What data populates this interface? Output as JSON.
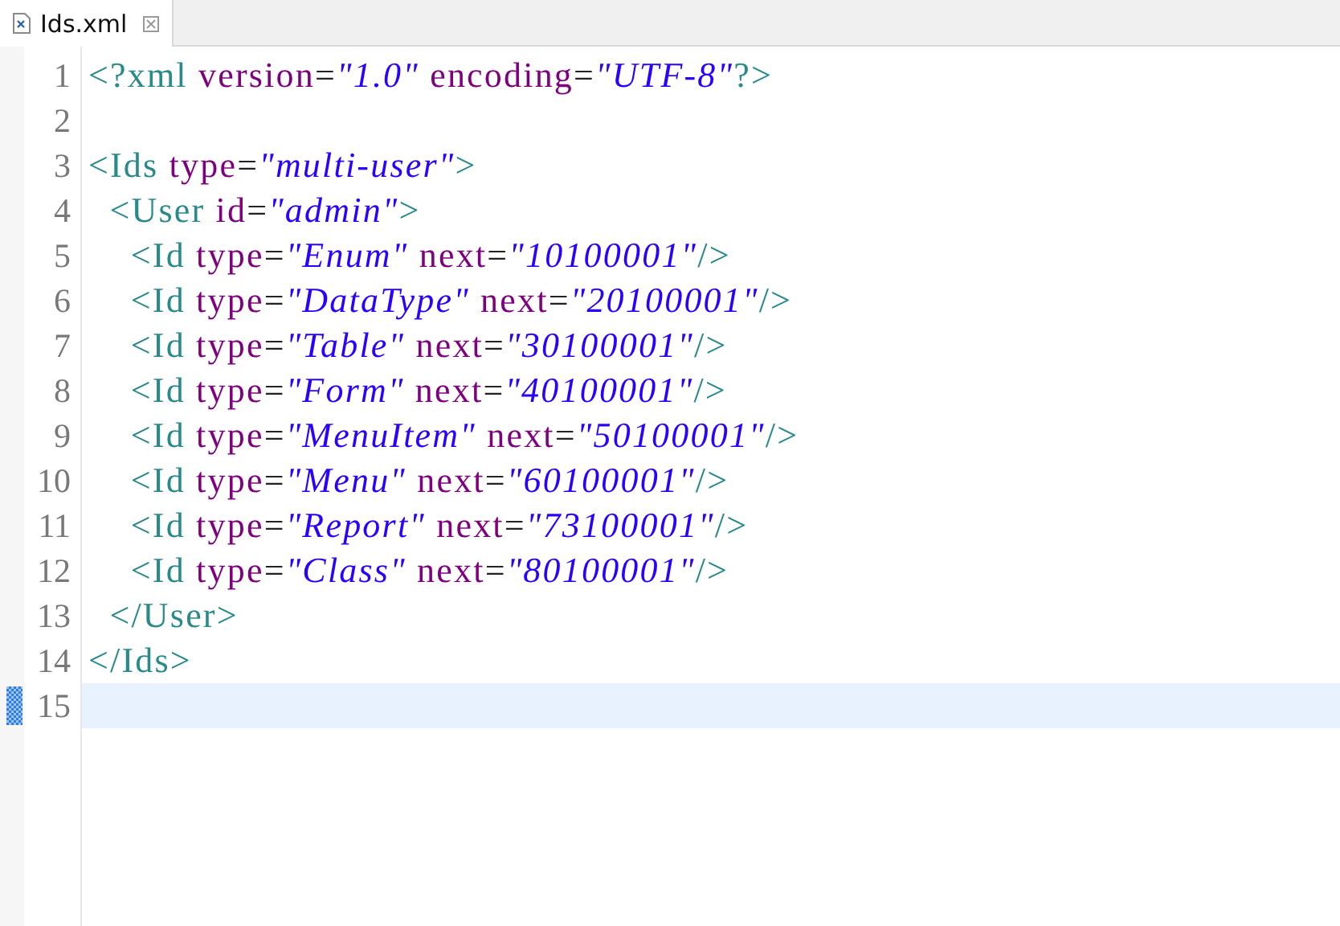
{
  "tabs": [
    {
      "title": "Ids.xml",
      "selected": true
    }
  ],
  "lines": [
    {
      "number": "1",
      "current": false,
      "tokens": [
        {
          "kind": "tag",
          "text": "<?xml"
        },
        {
          "kind": "attr",
          "text": " version"
        },
        {
          "kind": "eq",
          "text": "="
        },
        {
          "kind": "value",
          "text": "\"1.0\""
        },
        {
          "kind": "attr",
          "text": " encoding"
        },
        {
          "kind": "eq",
          "text": "="
        },
        {
          "kind": "value",
          "text": "\"UTF-8\""
        },
        {
          "kind": "tag",
          "text": "?>"
        }
      ]
    },
    {
      "number": "2",
      "current": false
    },
    {
      "number": "3",
      "current": false,
      "tokens": [
        {
          "kind": "tag",
          "text": "<Ids"
        },
        {
          "kind": "attr",
          "text": " type"
        },
        {
          "kind": "eq",
          "text": "="
        },
        {
          "kind": "value",
          "text": "\"multi-user\""
        },
        {
          "kind": "tag",
          "text": ">"
        }
      ]
    },
    {
      "number": "4",
      "current": false,
      "tokens": [
        {
          "kind": "tag",
          "text": "  <User"
        },
        {
          "kind": "attr",
          "text": " id"
        },
        {
          "kind": "eq",
          "text": "="
        },
        {
          "kind": "value",
          "text": "\"admin\""
        },
        {
          "kind": "tag",
          "text": ">"
        }
      ]
    },
    {
      "number": "5",
      "current": false,
      "tokens": [
        {
          "kind": "tag",
          "text": "    <Id"
        },
        {
          "kind": "attr",
          "text": " type"
        },
        {
          "kind": "eq",
          "text": "="
        },
        {
          "kind": "value",
          "text": "\"Enum\""
        },
        {
          "kind": "attr",
          "text": " next"
        },
        {
          "kind": "eq",
          "text": "="
        },
        {
          "kind": "value",
          "text": "\"10100001\""
        },
        {
          "kind": "tag",
          "text": "/>"
        }
      ]
    },
    {
      "number": "6",
      "current": false,
      "tokens": [
        {
          "kind": "tag",
          "text": "    <Id"
        },
        {
          "kind": "attr",
          "text": " type"
        },
        {
          "kind": "eq",
          "text": "="
        },
        {
          "kind": "value",
          "text": "\"DataType\""
        },
        {
          "kind": "attr",
          "text": " next"
        },
        {
          "kind": "eq",
          "text": "="
        },
        {
          "kind": "value",
          "text": "\"20100001\""
        },
        {
          "kind": "tag",
          "text": "/>"
        }
      ]
    },
    {
      "number": "7",
      "current": false,
      "tokens": [
        {
          "kind": "tag",
          "text": "    <Id"
        },
        {
          "kind": "attr",
          "text": " type"
        },
        {
          "kind": "eq",
          "text": "="
        },
        {
          "kind": "value",
          "text": "\"Table\""
        },
        {
          "kind": "attr",
          "text": " next"
        },
        {
          "kind": "eq",
          "text": "="
        },
        {
          "kind": "value",
          "text": "\"30100001\""
        },
        {
          "kind": "tag",
          "text": "/>"
        }
      ]
    },
    {
      "number": "8",
      "current": false,
      "tokens": [
        {
          "kind": "tag",
          "text": "    <Id"
        },
        {
          "kind": "attr",
          "text": " type"
        },
        {
          "kind": "eq",
          "text": "="
        },
        {
          "kind": "value",
          "text": "\"Form\""
        },
        {
          "kind": "attr",
          "text": " next"
        },
        {
          "kind": "eq",
          "text": "="
        },
        {
          "kind": "value",
          "text": "\"40100001\""
        },
        {
          "kind": "tag",
          "text": "/>"
        }
      ]
    },
    {
      "number": "9",
      "current": false,
      "tokens": [
        {
          "kind": "tag",
          "text": "    <Id"
        },
        {
          "kind": "attr",
          "text": " type"
        },
        {
          "kind": "eq",
          "text": "="
        },
        {
          "kind": "value",
          "text": "\"MenuItem\""
        },
        {
          "kind": "attr",
          "text": " next"
        },
        {
          "kind": "eq",
          "text": "="
        },
        {
          "kind": "value",
          "text": "\"50100001\""
        },
        {
          "kind": "tag",
          "text": "/>"
        }
      ]
    },
    {
      "number": "10",
      "current": false,
      "tokens": [
        {
          "kind": "tag",
          "text": "    <Id"
        },
        {
          "kind": "attr",
          "text": " type"
        },
        {
          "kind": "eq",
          "text": "="
        },
        {
          "kind": "value",
          "text": "\"Menu\""
        },
        {
          "kind": "attr",
          "text": " next"
        },
        {
          "kind": "eq",
          "text": "="
        },
        {
          "kind": "value",
          "text": "\"60100001\""
        },
        {
          "kind": "tag",
          "text": "/>"
        }
      ]
    },
    {
      "number": "11",
      "current": false,
      "tokens": [
        {
          "kind": "tag",
          "text": "    <Id"
        },
        {
          "kind": "attr",
          "text": " type"
        },
        {
          "kind": "eq",
          "text": "="
        },
        {
          "kind": "value",
          "text": "\"Report\""
        },
        {
          "kind": "attr",
          "text": " next"
        },
        {
          "kind": "eq",
          "text": "="
        },
        {
          "kind": "value",
          "text": "\"73100001\""
        },
        {
          "kind": "tag",
          "text": "/>"
        }
      ]
    },
    {
      "number": "12",
      "current": false,
      "tokens": [
        {
          "kind": "tag",
          "text": "    <Id"
        },
        {
          "kind": "attr",
          "text": " type"
        },
        {
          "kind": "eq",
          "text": "="
        },
        {
          "kind": "value",
          "text": "\"Class\""
        },
        {
          "kind": "attr",
          "text": " next"
        },
        {
          "kind": "eq",
          "text": "="
        },
        {
          "kind": "value",
          "text": "\"80100001\""
        },
        {
          "kind": "tag",
          "text": "/>"
        }
      ]
    },
    {
      "number": "13",
      "current": false,
      "tokens": [
        {
          "kind": "tag",
          "text": "  </User>"
        }
      ]
    },
    {
      "number": "14",
      "current": false,
      "tokens": [
        {
          "kind": "tag",
          "text": "</Ids>"
        }
      ]
    },
    {
      "number": "15",
      "current": true
    }
  ]
}
